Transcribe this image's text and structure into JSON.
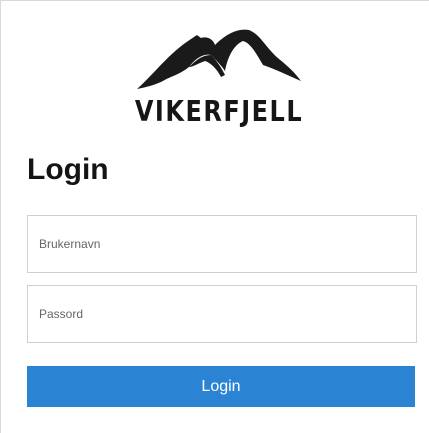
{
  "brand": {
    "name": "VIKERFJELL",
    "logo_icon": "mountain-icon"
  },
  "form": {
    "title": "Login",
    "username_placeholder": "Brukernavn",
    "username_value": "",
    "password_placeholder": "Passord",
    "password_value": "",
    "submit_label": "Login"
  },
  "colors": {
    "button": "#2b83d4",
    "button_text": "#ffffff",
    "text": "#141414"
  }
}
